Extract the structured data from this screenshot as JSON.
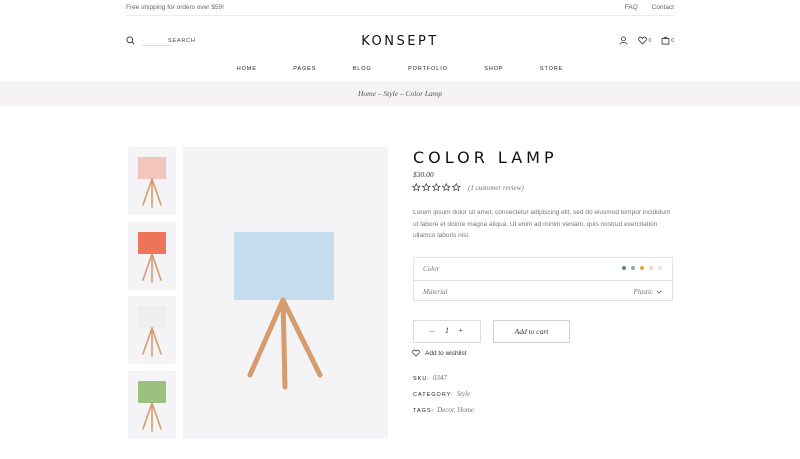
{
  "topbar": {
    "shipping": "Free shipping for orders over $59!",
    "faq": "FAQ",
    "contact": "Contact"
  },
  "header": {
    "search_label": "SEARCH",
    "logo": "KONSEPT",
    "wishlist_count": "0",
    "cart_count": "0"
  },
  "nav": [
    "HOME",
    "PAGES",
    "BLOG",
    "PORTFOLIO",
    "SHOP",
    "STORE"
  ],
  "breadcrumb": "Home – Style – Color Lamp",
  "product": {
    "title": "COLOR LAMP",
    "price": "$30.00",
    "rating": 0,
    "rating_max": 5,
    "review_text": "(1 customer review)",
    "description": "Lorem ipsum dolor sit amet, consectetur adipiscing elit, sed do eiusmod tempor incididunt ut labore et dolore magna aliqua. Ut enim ad minim veniam, quis nostrud exercitation ullamco laboris nisi.",
    "color_label": "Color",
    "swatches": [
      "#5b8a78",
      "#9aa5b1",
      "#e1a440",
      "#f2d7cd",
      "#e4e4e4"
    ],
    "material_label": "Material",
    "material_value": "Plastic",
    "quantity": "1",
    "qty_minus": "–",
    "qty_plus": "+",
    "add_to_cart": "Add to cart",
    "wishlist": "Add to wishlist",
    "sku_label": "SKU:",
    "sku": "0347",
    "category_label": "CATEGORY:",
    "category": "Style",
    "tags_label": "TAGS:",
    "tags": "Decor, Home"
  },
  "thumbnails": [
    {
      "shade": "#f3c6bd",
      "name": "pink"
    },
    {
      "shade": "#ec7457",
      "name": "orange"
    },
    {
      "shade": "#eeeeee",
      "name": "white"
    },
    {
      "shade": "#9cc07d",
      "name": "green"
    }
  ],
  "main_image": {
    "shade": "#c4dceb",
    "wood": "#d69c6e"
  }
}
